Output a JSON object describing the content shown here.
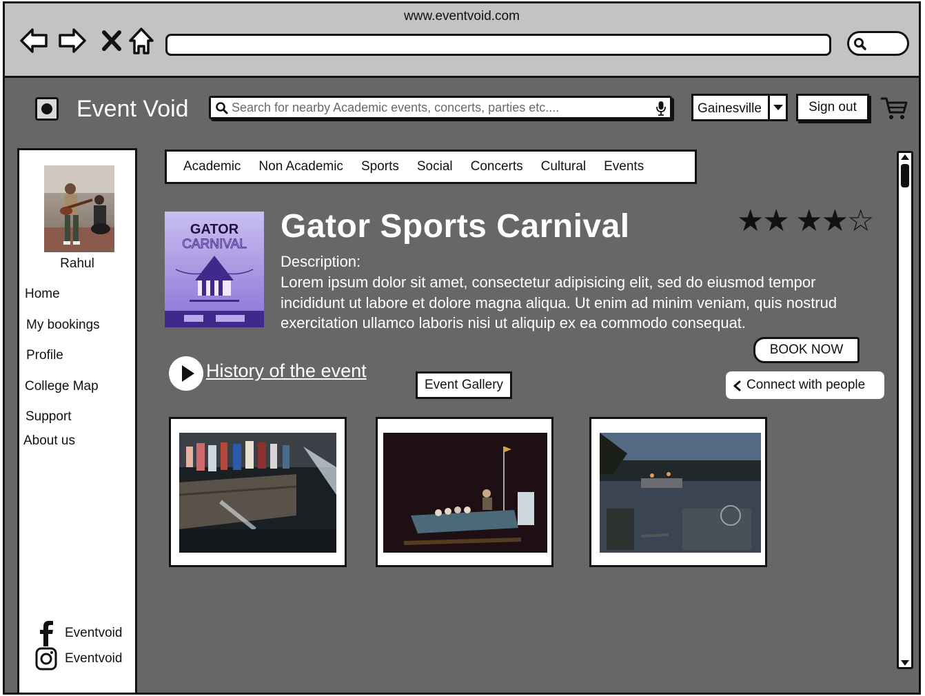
{
  "browser": {
    "url": "www.eventvoid.com"
  },
  "header": {
    "brand": "Event Void",
    "search_placeholder": "Search for nearby Academic events, concerts, parties etc....",
    "city": "Gainesville",
    "signout_label": "Sign out"
  },
  "sidebar": {
    "user_name": "Rahul",
    "items": [
      {
        "label": "Home"
      },
      {
        "label": "My bookings"
      },
      {
        "label": "Profile"
      },
      {
        "label": "College Map"
      },
      {
        "label": "Support"
      },
      {
        "label": "About us"
      }
    ],
    "social": [
      {
        "icon": "facebook-icon",
        "label": "Eventvoid"
      },
      {
        "icon": "instagram-icon",
        "label": "Eventvoid"
      }
    ]
  },
  "tabs": [
    {
      "label": "Academic"
    },
    {
      "label": "Non Academic"
    },
    {
      "label": "Sports"
    },
    {
      "label": "Social"
    },
    {
      "label": "Concerts"
    },
    {
      "label": "Cultural"
    },
    {
      "label": "Events"
    }
  ],
  "event": {
    "poster": {
      "line1": "GATOR",
      "line2": "CARNIVAL"
    },
    "title": "Gator Sports Carnival",
    "rating": {
      "value": 4,
      "max": 5
    },
    "description_label": "Description:",
    "description": "Lorem ipsum dolor sit amet, consectetur adipisicing elit, sed do eiusmod tempor incididunt ut labore et dolore magna aliqua. Ut enim ad minim veniam, quis nostrud exercitation ullamco laboris nisi ut aliquip ex ea commodo consequat.",
    "book_label": "BOOK NOW",
    "history_label": "History of the event",
    "gallery_label": "Event Gallery",
    "connect_label": "Connect with people"
  },
  "colors": {
    "page_bg": "#676767",
    "chrome_bg": "#c3c3c3",
    "poster_purple": "#7b5fc4"
  }
}
